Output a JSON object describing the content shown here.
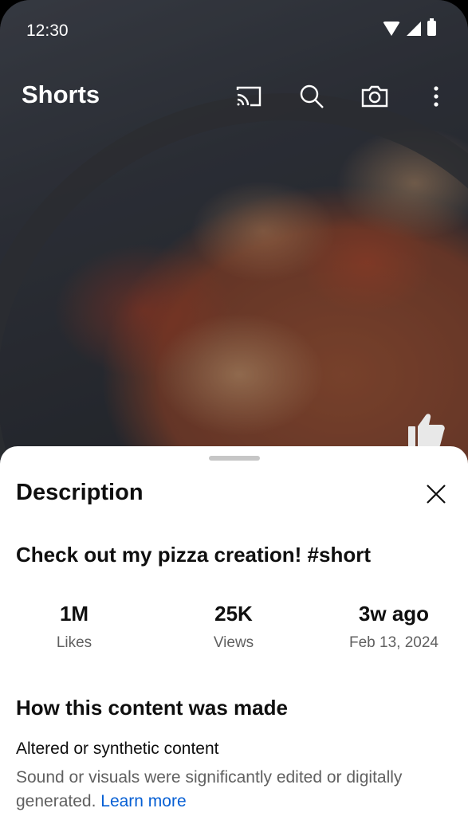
{
  "status_bar": {
    "time": "12:30"
  },
  "header": {
    "title": "Shorts"
  },
  "icons": {
    "cast": "cast-icon",
    "search": "search-icon",
    "camera": "camera-icon",
    "more": "more-vert-icon",
    "like": "thumb-up-icon",
    "close": "close-icon"
  },
  "sheet": {
    "title": "Description",
    "video_title": "Check out my pizza creation! #short",
    "stats": [
      {
        "value": "1M",
        "label": "Likes"
      },
      {
        "value": "25K",
        "label": "Views"
      },
      {
        "value": "3w ago",
        "label": "Feb 13, 2024"
      }
    ],
    "made_section_title": "How this content was made",
    "disclosure_title": "Altered or synthetic content",
    "disclosure_text": "Sound or visuals were significantly edited or digitally generated.",
    "learn_more": "Learn more"
  },
  "colors": {
    "link": "#065fd4",
    "secondary_text": "#606060",
    "primary_text": "#0f0f0f"
  }
}
